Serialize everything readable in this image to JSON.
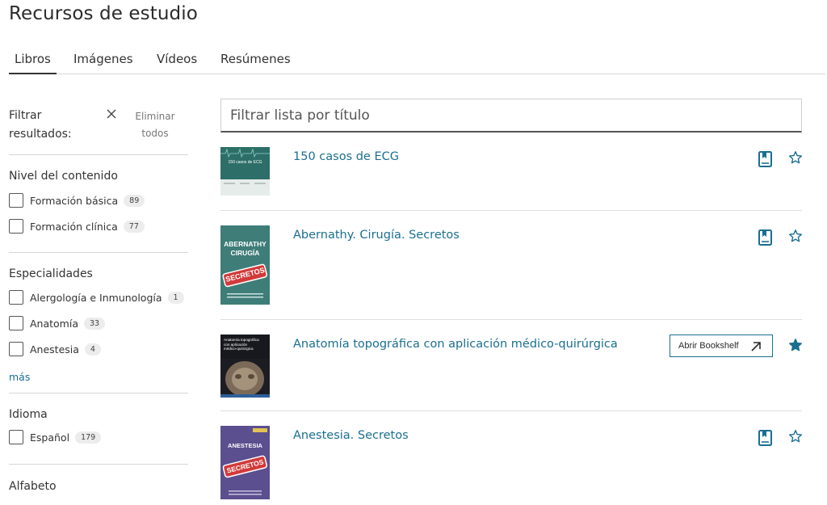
{
  "page": {
    "title": "Recursos de estudio"
  },
  "tabs": [
    {
      "label": "Libros",
      "active": true
    },
    {
      "label": "Imágenes",
      "active": false
    },
    {
      "label": "Vídeos",
      "active": false
    },
    {
      "label": "Resúmenes",
      "active": false
    }
  ],
  "filters": {
    "header_label": "Filtrar resultados:",
    "clear_all_label": "Eliminar todos",
    "sections": [
      {
        "title": "Nivel del contenido",
        "options": [
          {
            "label": "Formación básica",
            "count": "89",
            "checked": false
          },
          {
            "label": "Formación clínica",
            "count": "77",
            "checked": false
          }
        ]
      },
      {
        "title": "Especialidades",
        "options": [
          {
            "label": "Alergología e Inmunología",
            "count": "1",
            "checked": false
          },
          {
            "label": "Anatomía",
            "count": "33",
            "checked": false
          },
          {
            "label": "Anestesia",
            "count": "4",
            "checked": false
          }
        ],
        "more_label": "más"
      },
      {
        "title": "Idioma",
        "options": [
          {
            "label": "Español",
            "count": "179",
            "checked": false
          }
        ]
      },
      {
        "title": "Alfabeto"
      }
    ]
  },
  "search": {
    "placeholder": "Filtrar lista por título",
    "value": ""
  },
  "books": [
    {
      "title": "150 casos de ECG",
      "favorited": false,
      "show_open_button": false,
      "cover_style": "ecg",
      "cover_text": "150 casos de ECG"
    },
    {
      "title": "Abernathy. Cirugía. Secretos",
      "favorited": false,
      "show_open_button": false,
      "cover_style": "secretos-teal",
      "cover_text": "ABERNATHY CIRUGÍA",
      "cover_badge": "SECRETOS"
    },
    {
      "title": "Anatomía topográfica con aplicación médico-quirúrgica",
      "favorited": true,
      "show_open_button": true,
      "open_button_label": "Abrir Bookshelf",
      "cover_style": "anatomy",
      "cover_text": "Anatomía topográfica con aplicación médico-quirúrgica"
    },
    {
      "title": "Anestesia. Secretos",
      "favorited": false,
      "show_open_button": false,
      "cover_style": "secretos-purple",
      "cover_text": "ANESTESIA",
      "cover_badge": "SECRETOS"
    }
  ],
  "colors": {
    "accent": "#1b6f90",
    "text": "#333333",
    "divider": "#d6d6d6",
    "badge_red": "#d23a3a"
  },
  "icons": {
    "clear": "close-icon",
    "bookmark": "book-bookmark-icon",
    "star_empty": "star-outline-icon",
    "star_filled": "star-filled-icon",
    "external": "arrow-up-right-icon"
  }
}
